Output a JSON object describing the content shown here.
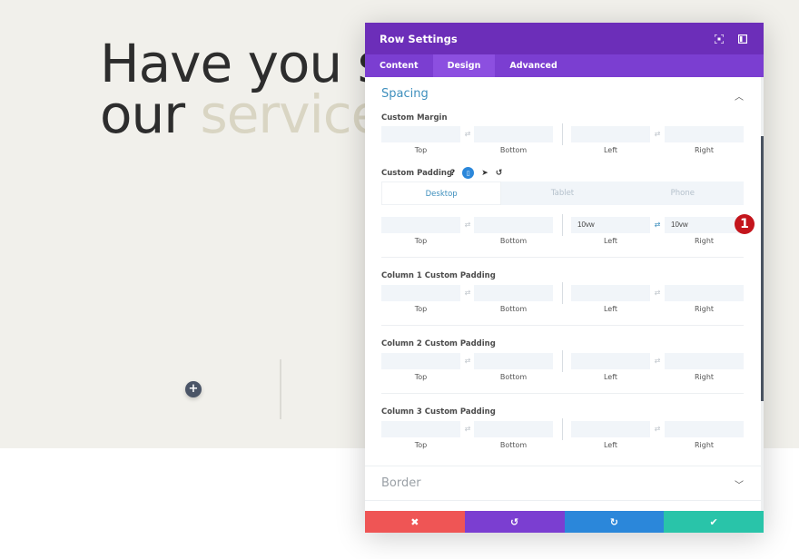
{
  "hero": {
    "line1": "Have you s",
    "line2_dark": "our ",
    "line2_accent": "service"
  },
  "modal": {
    "title": "Row Settings",
    "header_icons": [
      "expand-icon",
      "sidebar-icon"
    ],
    "tabs": [
      {
        "label": "Content",
        "active": false
      },
      {
        "label": "Design",
        "active": true
      },
      {
        "label": "Advanced",
        "active": false
      }
    ],
    "spacing": {
      "title": "Spacing",
      "custom_margin": {
        "label": "Custom Margin",
        "top": "",
        "bottom": "",
        "left": "",
        "right": ""
      },
      "custom_padding": {
        "label": "Custom Padding",
        "help": "?",
        "device_tabs": [
          {
            "label": "Desktop",
            "active": true
          },
          {
            "label": "Tablet",
            "active": false
          },
          {
            "label": "Phone",
            "active": false
          }
        ],
        "top": "",
        "bottom": "",
        "left": "10vw",
        "right": "10vw",
        "lr_linked": true
      },
      "column1": {
        "label": "Column 1 Custom Padding",
        "top": "",
        "bottom": "",
        "left": "",
        "right": ""
      },
      "column2": {
        "label": "Column 2 Custom Padding",
        "top": "",
        "bottom": "",
        "left": "",
        "right": ""
      },
      "column3": {
        "label": "Column 3 Custom Padding",
        "top": "",
        "bottom": "",
        "left": "",
        "right": ""
      }
    },
    "sublabels": {
      "top": "Top",
      "bottom": "Bottom",
      "left": "Left",
      "right": "Right"
    },
    "border": {
      "title": "Border"
    },
    "step_badge": "1",
    "footer": {
      "cancel": "✖",
      "undo": "↺",
      "redo": "↻",
      "save": "✔"
    }
  },
  "colors": {
    "purple_header": "#6c2eb9",
    "purple_tabs": "#7b3ed1",
    "accent_blue": "#3e8fbd",
    "cancel_red": "#ef5555",
    "save_green": "#29c4a9",
    "redo_blue": "#2b87da",
    "badge_red": "#c4151c"
  }
}
